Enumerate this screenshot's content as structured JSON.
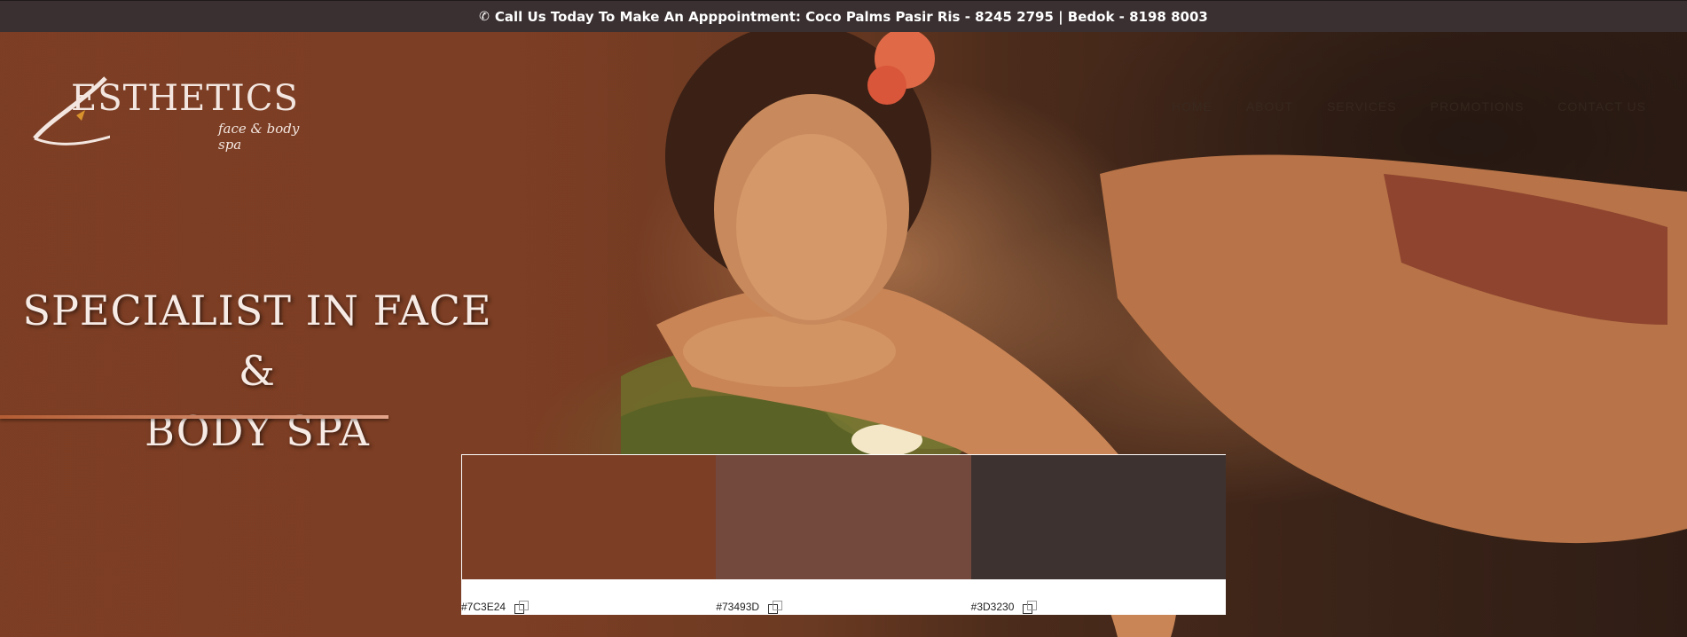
{
  "topbar": {
    "phone_icon": "phone-icon",
    "text": "Call Us Today To Make An Apppointment: Coco Palms Pasir Ris - 8245 2795 | Bedok - 8198 8003"
  },
  "logo": {
    "main": "ESTHETICS",
    "sub": "face & body spa",
    "initial": "A"
  },
  "nav": [
    "HOME",
    "ABOUT",
    "SERVICES",
    "PROMOTIONS",
    "CONTACT US"
  ],
  "hero": {
    "headline_line1": "SPECIALIST IN FACE &",
    "headline_line2": "BODY SPA"
  },
  "palette": [
    {
      "color": "#7C3E24",
      "label": "#7C3E24"
    },
    {
      "color": "#73493D",
      "label": "#73493D"
    },
    {
      "color": "#3D3230",
      "label": "#3D3230"
    }
  ]
}
